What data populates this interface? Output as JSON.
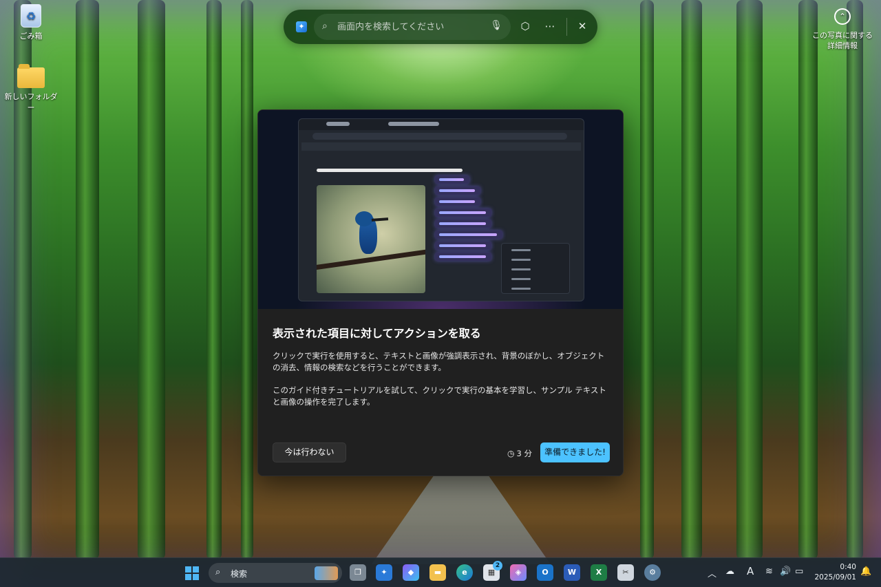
{
  "desktop": {
    "icons": [
      {
        "label": "ごみ箱",
        "icon": "recycle-bin-icon"
      },
      {
        "label": "新しいフォルダー",
        "icon": "folder-icon"
      }
    ],
    "info_corner_label": "この写真に関する詳細情報"
  },
  "search_bar": {
    "placeholder": "画面内を検索してください",
    "icons": [
      "copilot-logo-icon",
      "search-icon",
      "microphone-icon",
      "cube-icon",
      "more-icon",
      "close-icon"
    ]
  },
  "dialog": {
    "title": "表示された項目に対してアクションを取る",
    "paragraph_1": "クリックで実行を使用すると、テキストと画像が強調表示され、背景のぼかし、オブジェクトの消去、情報の検索などを行うことができます。",
    "paragraph_2": "このガイド付きチュートリアルを試して、クリックで実行の基本を学習し、サンプル テキストと画像の操作を完了します。",
    "secondary_button": "今は行わない",
    "duration": "3 分",
    "primary_button": "準備できました!"
  },
  "taskbar": {
    "search_label": "検索",
    "store_badge": "2",
    "time": "0:40",
    "date": "2025/09/01",
    "ime_indicator": "A",
    "colors": {
      "accent": "#4cc2ff",
      "taskbar_bg": "#1c2830"
    }
  }
}
